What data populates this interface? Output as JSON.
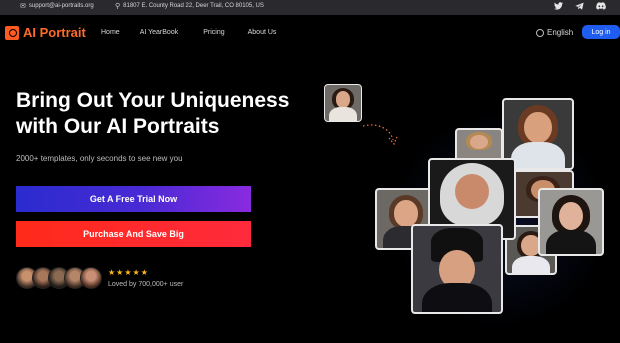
{
  "topbar": {
    "email": "support@ai-portraits.org",
    "address": "81807 E. County Road 22, Deer Trail, CO 80105, US",
    "socials": [
      "twitter-icon",
      "telegram-icon",
      "discord-icon"
    ]
  },
  "nav": {
    "brand": "AI Portrait",
    "links": [
      "Home",
      "AI YearBook",
      "Pricing",
      "About Us"
    ],
    "language": "English",
    "login": "Log in"
  },
  "hero": {
    "title_line1": "Bring Out Your Uniqueness",
    "title_line2": "with Our AI Portraits",
    "subtitle": "2000+ templates, only seconds to see new you",
    "trial_button": "Get A Free Trial Now",
    "purchase_button": "Purchase And Save Big",
    "stars": "★★★★★",
    "rating": 5,
    "loved_text": "Loved by 700,000+ user"
  },
  "colors": {
    "brand": "#ff6a2a",
    "login": "#1f5cf0",
    "trial_gradient": "#2a2bcf-#8a2ae0",
    "purchase": "#ff2a1a",
    "stars": "#ffb81c"
  }
}
